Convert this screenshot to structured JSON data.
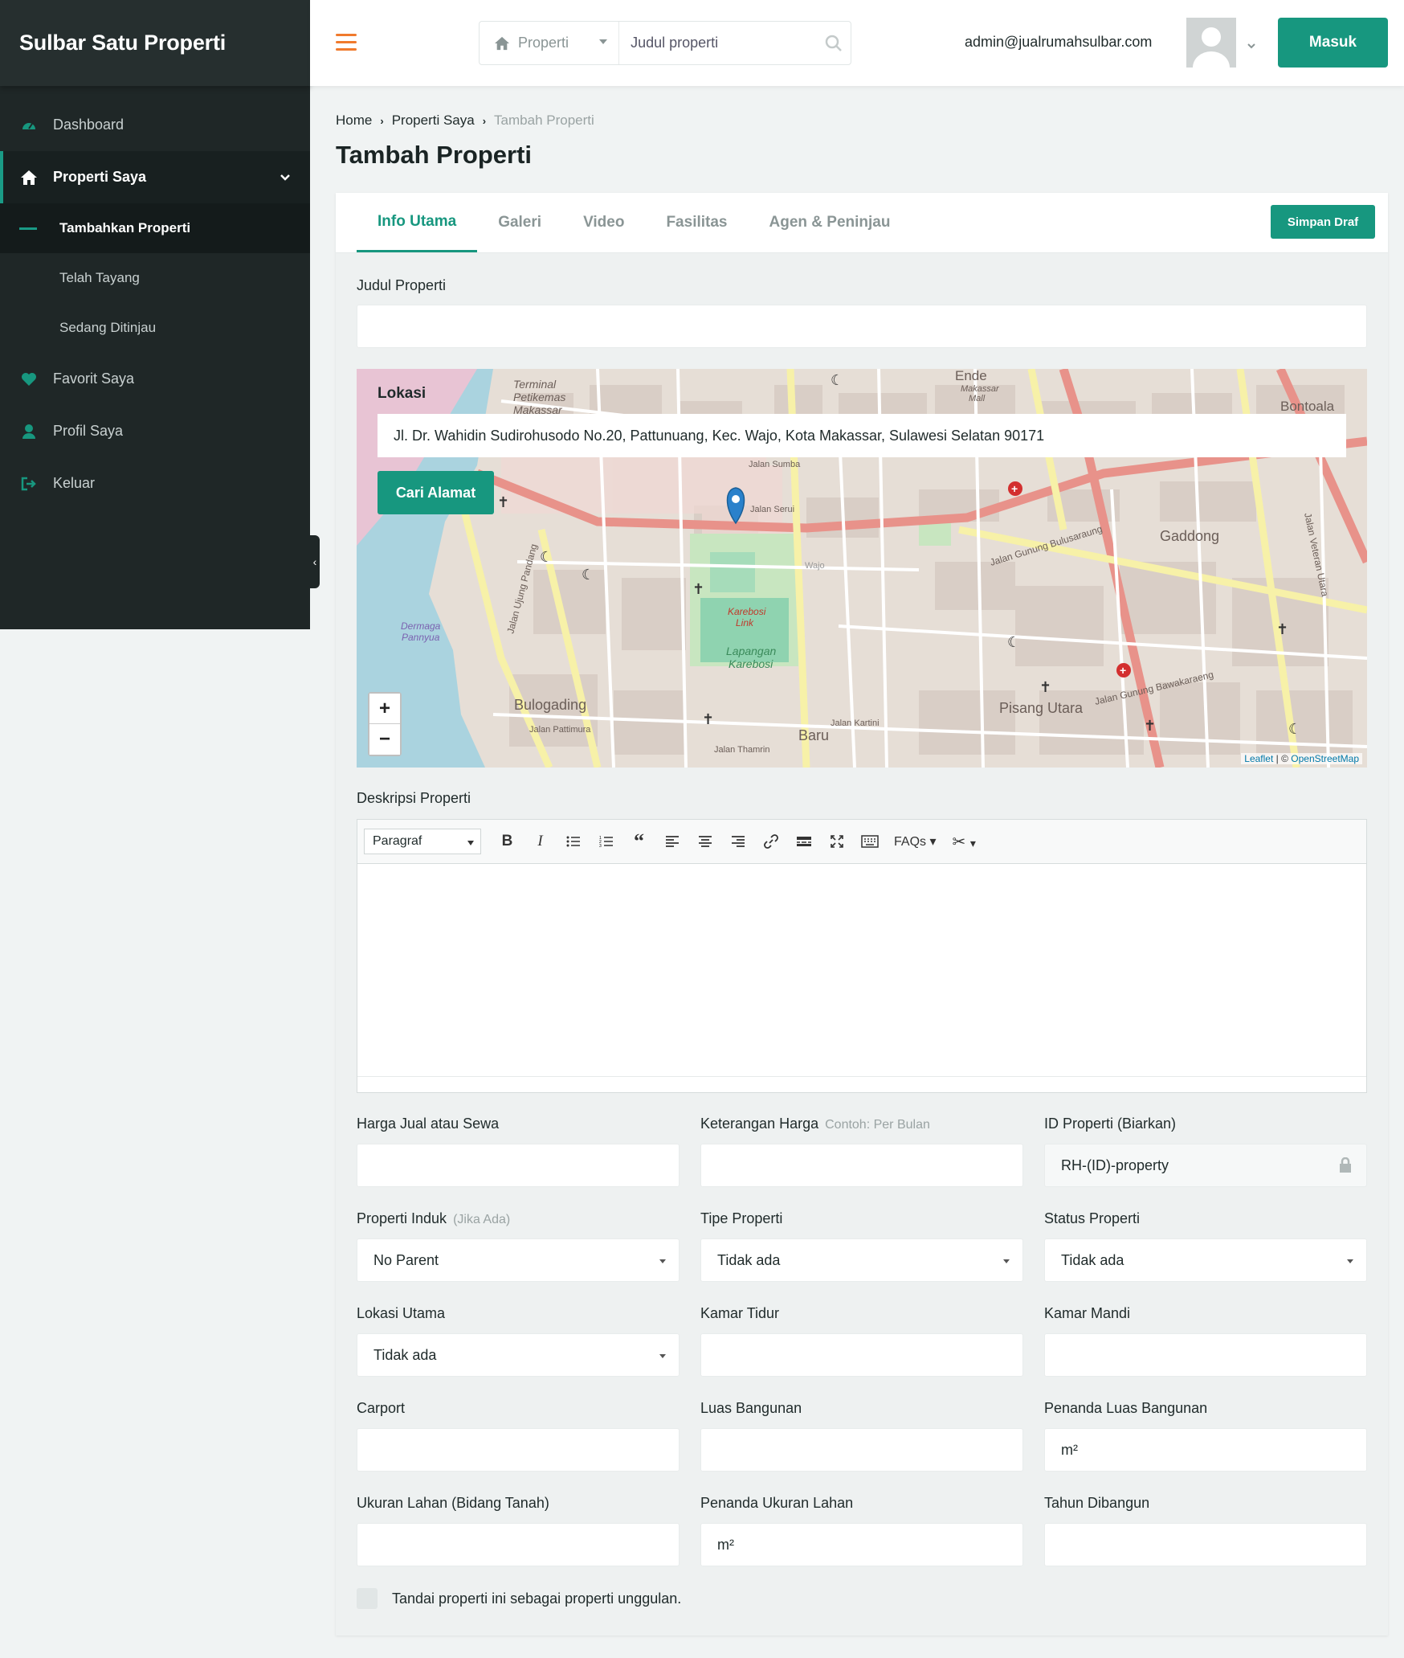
{
  "sidebar": {
    "brand": "Sulbar Satu Properti",
    "items": [
      {
        "label": "Dashboard"
      },
      {
        "label": "Properti Saya"
      },
      {
        "label": "Favorit Saya"
      },
      {
        "label": "Profil Saya"
      },
      {
        "label": "Keluar"
      }
    ],
    "sub_items": [
      {
        "label": "Tambahkan Properti"
      },
      {
        "label": "Telah Tayang"
      },
      {
        "label": "Sedang Ditinjau"
      }
    ]
  },
  "topbar": {
    "search_type": "Properti",
    "search_placeholder": "Judul properti",
    "user_email": "admin@jualrumahsulbar.com",
    "login_button": "Masuk"
  },
  "breadcrumb": [
    "Home",
    "Properti Saya",
    "Tambah Properti"
  ],
  "page_title": "Tambah Properti",
  "tabs": [
    "Info Utama",
    "Galeri",
    "Video",
    "Fasilitas",
    "Agen & Peninjau"
  ],
  "save_draft": "Simpan Draf",
  "form": {
    "judul_label": "Judul Properti",
    "map": {
      "title": "Lokasi",
      "address": "Jl. Dr. Wahidin Sudirohusodo No.20, Pattunuang, Kec. Wajo, Kota Makassar, Sulawesi Selatan 90171",
      "search_button": "Cari Alamat",
      "zoom_in": "+",
      "zoom_out": "−",
      "attribution_leaflet": "Leaflet",
      "attribution_osm": "OpenStreetMap",
      "place_labels": [
        "Terminal",
        "Petikemas",
        "Makassar",
        "Ende",
        "Makassar",
        "Mall",
        "Bontoala",
        "Gaddong",
        "Bulogading",
        "Baru",
        "Pisang Utara",
        "Karebosi",
        "Link",
        "Lapangan",
        "Karebosi",
        "Dermaga",
        "Pannyua",
        "Jalan Gunung Bulusaraung",
        "Jalan Gunung Bawakaraeng",
        "Jalan Ujung Pandang",
        "Jalan Veteran Utara",
        "Jalan Kartini",
        "Jalan Thamrin",
        "Jalan Pattimura",
        "Jalan Serui",
        "Jalan Sumba",
        "Wajo"
      ]
    },
    "deskripsi_label": "Deskripsi Properti",
    "editor": {
      "format": "Paragraf",
      "faqs": "FAQs"
    },
    "fields": {
      "harga_label": "Harga Jual atau Sewa",
      "keterangan_label": "Keterangan Harga",
      "keterangan_hint": "Contoh: Per Bulan",
      "id_label": "ID Properti (Biarkan)",
      "id_value": "RH-(ID)-property",
      "induk_label": "Properti Induk",
      "induk_hint": "(Jika Ada)",
      "induk_value": "No Parent",
      "tipe_label": "Tipe Properti",
      "tipe_value": "Tidak ada",
      "status_label": "Status Properti",
      "status_value": "Tidak ada",
      "lokasi_label": "Lokasi Utama",
      "lokasi_value": "Tidak ada",
      "kamar_tidur_label": "Kamar Tidur",
      "kamar_mandi_label": "Kamar Mandi",
      "carport_label": "Carport",
      "luas_bangunan_label": "Luas Bangunan",
      "penanda_luas_label": "Penanda Luas Bangunan",
      "penanda_luas_value": "m²",
      "ukuran_lahan_label": "Ukuran Lahan (Bidang Tanah)",
      "penanda_lahan_label": "Penanda Ukuran Lahan",
      "penanda_lahan_value": "m²",
      "tahun_label": "Tahun Dibangun"
    },
    "featured_label": "Tandai properti ini sebagai properti unggulan."
  },
  "colors": {
    "accent": "#17977f",
    "sidebar": "#1f2727",
    "hamburger": "#f07a2d"
  }
}
